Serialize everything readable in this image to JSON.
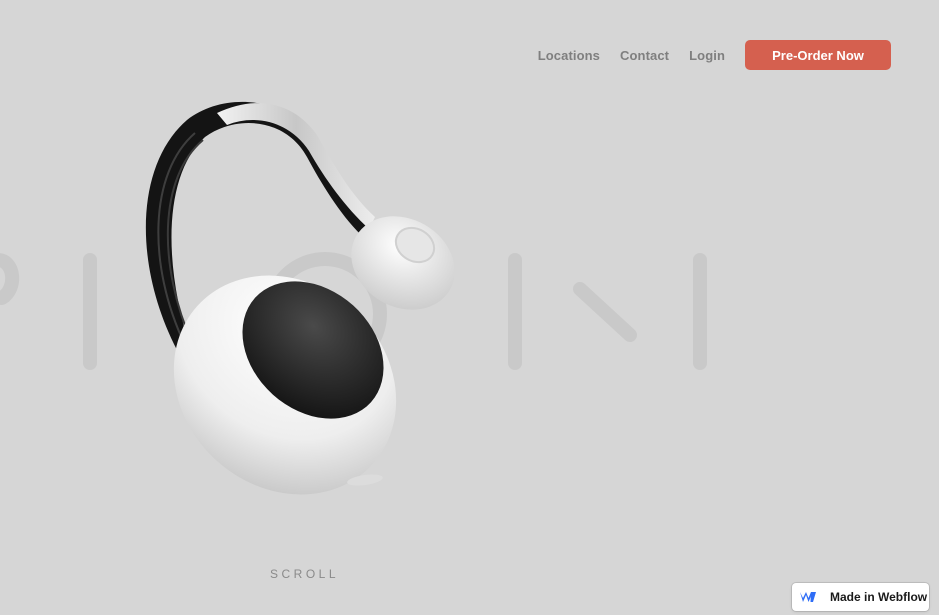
{
  "nav": {
    "links": [
      "Locations",
      "Contact",
      "Login"
    ],
    "cta_label": "Pre-Order Now"
  },
  "hero": {
    "scroll_label": "SCROLL",
    "product_image": "white-headphones-render",
    "background_letters": "faded-giant-wordmark"
  },
  "badge": {
    "label": "Made in Webflow",
    "icon": "webflow-logo-icon"
  },
  "colors": {
    "background": "#d6d6d6",
    "accent": "#d5604f",
    "nav_text": "#7f7f7f"
  }
}
